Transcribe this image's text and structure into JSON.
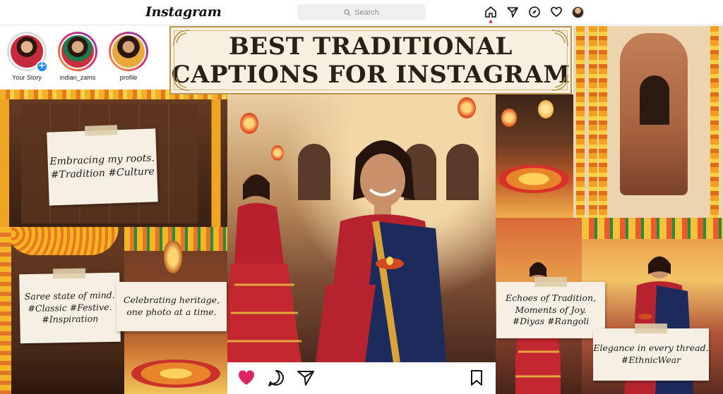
{
  "app": {
    "logo": "Instagram"
  },
  "search": {
    "placeholder": "Search"
  },
  "nav": {
    "icons": [
      "home-icon",
      "send-icon",
      "explore-icon",
      "heart-icon",
      "profile-avatar"
    ]
  },
  "stories": [
    {
      "name": "Your Story",
      "has_add": true
    },
    {
      "name": "indian_zams",
      "has_add": false
    },
    {
      "name": "profile",
      "has_add": false
    }
  ],
  "banner": {
    "line1": "BEST TRADITIONAL",
    "line2": "CAPTIONS FOR INSTAGRAM"
  },
  "captions": {
    "c1": "Embracing my roots.\n#Tradition #Culture",
    "c2": "Saree state of mind.\n#Classic #Festive.\n#Inspiration",
    "c3": "Celebrating heritage,\none photo at a time.",
    "c4": "Echoes of Tradition,\nMoments of Joy.\n#Diyas #Rangoli",
    "c5": "Elegance in every thread.\n#EthnicWear"
  },
  "actions": {
    "icons": [
      "like-heart-icon",
      "comment-icon",
      "share-icon",
      "bookmark-icon"
    ],
    "liked": true
  },
  "colors": {
    "accent_like": "#e0245e",
    "banner_bg": "#f7efe0",
    "banner_border": "#b9954f",
    "marigold": "#f0a424"
  }
}
